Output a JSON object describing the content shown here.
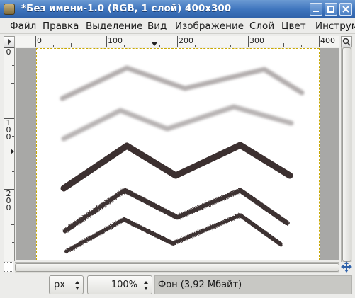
{
  "window": {
    "title": "*Без имени-1.0 (RGB, 1 слой) 400x300"
  },
  "menubar": {
    "items": [
      {
        "label": "Файл"
      },
      {
        "label": "Правка"
      },
      {
        "label": "Выделение"
      },
      {
        "label": "Вид"
      },
      {
        "label": "Изображение"
      },
      {
        "label": "Слой"
      },
      {
        "label": "Цвет"
      },
      {
        "label": "Инструм"
      }
    ]
  },
  "hruler": {
    "labels": [
      "0",
      "100",
      "200",
      "300",
      "400"
    ]
  },
  "vruler": {
    "labels": [
      {
        "lines": [
          "0"
        ]
      },
      {
        "lines": [
          "1",
          "0",
          "0"
        ]
      },
      {
        "lines": [
          "2",
          "0",
          "0"
        ]
      }
    ]
  },
  "statusbar": {
    "unit": "px",
    "zoom": "100%",
    "status": "Фон (3,92 Мбайт)"
  },
  "colors": {
    "titlebar": "#3e74bd",
    "stroke_light": "#b3aeae",
    "stroke_dark": "#3c3030",
    "selection_border": "#c8a800"
  },
  "icons": {
    "app": "gimp-wilber-icon",
    "minimize": "minimize-icon",
    "maximize": "maximize-icon",
    "close": "close-icon",
    "navigate": "navigate-icon"
  }
}
